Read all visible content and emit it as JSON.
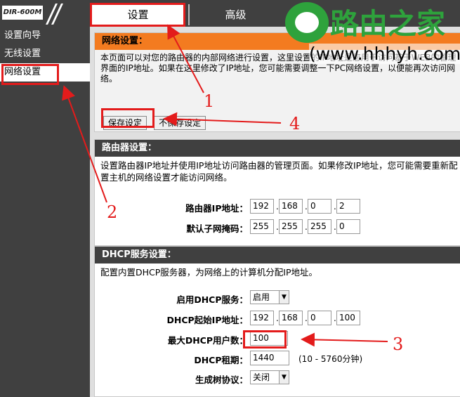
{
  "header": {
    "model": "DIR-600M",
    "tabs": [
      {
        "label": "设置",
        "active": true
      },
      {
        "label": "高级",
        "active": false
      }
    ]
  },
  "sidebar": {
    "items": [
      {
        "label": "设置向导",
        "active": false
      },
      {
        "label": "无线设置",
        "active": false
      },
      {
        "label": "网络设置",
        "active": true
      }
    ]
  },
  "network_settings": {
    "title": "网络设置：",
    "description": "本页面可以对您的路由器的内部网络进行设置，这里设置的IP地址是您用于访问基于WEB的管理界面的IP地址。如果在这里修改了IP地址，您可能需要调整一下PC网络设置，以便能再次访问网络。",
    "save_button": "保存设定",
    "dont_save_button": "不保存设定"
  },
  "router_settings": {
    "title": "路由器设置：",
    "description": "设置路由器IP地址并使用IP地址访问路由器的管理页面。如果修改IP地址，您可能需要重新配置主机的网络设置才能访问网络。",
    "ip_label": "路由器IP地址：",
    "ip": [
      "192",
      "168",
      "0",
      "2"
    ],
    "mask_label": "默认子网掩码：",
    "mask": [
      "255",
      "255",
      "255",
      "0"
    ]
  },
  "dhcp_settings": {
    "title": "DHCP服务设置：",
    "description": "配置内置DHCP服务器，为网络上的计算机分配IP地址。",
    "enable_label": "启用DHCP服务：",
    "enable_value": "启用",
    "start_ip_label": "DHCP起始IP地址：",
    "start_ip": [
      "192",
      "168",
      "0",
      "100"
    ],
    "max_users_label": "最大DHCP用户数：",
    "max_users": "100",
    "lease_label": "DHCP租期：",
    "lease": "1440",
    "lease_note": "(10 - 5760分钟)",
    "stp_label": "生成树协议：",
    "stp_value": "关闭"
  },
  "annotations": {
    "numbers": [
      "1",
      "2",
      "3",
      "4"
    ],
    "color": "#e31b1b"
  },
  "watermark": {
    "title": "路由之家",
    "url": "(www.hhhyh.com)"
  }
}
